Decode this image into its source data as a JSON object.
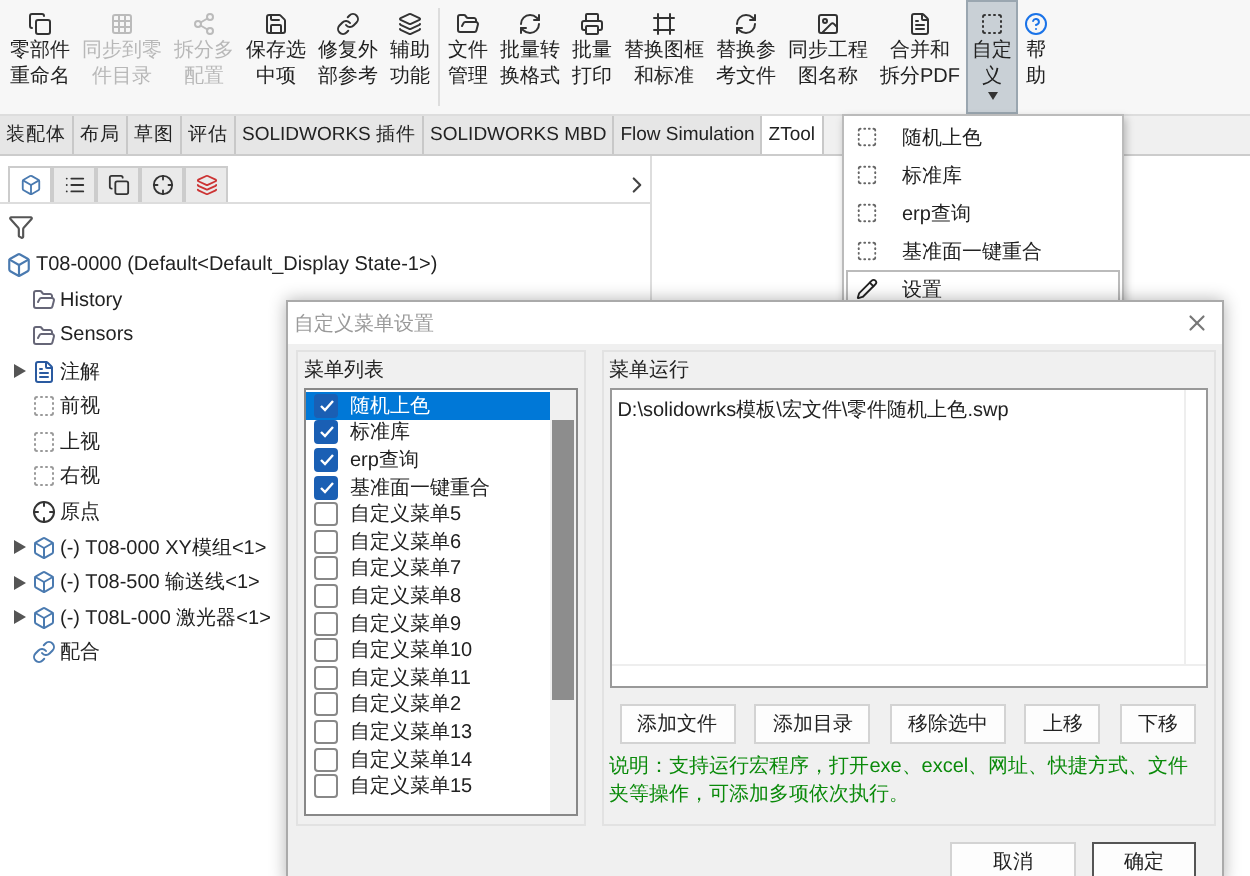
{
  "toolbar": {
    "buttons": [
      {
        "lines": [
          "零部件",
          "重命名"
        ],
        "disabled": false,
        "pressed": false
      },
      {
        "lines": [
          "同步到零",
          "件目录"
        ],
        "disabled": true,
        "pressed": false
      },
      {
        "lines": [
          "拆分多",
          "配置"
        ],
        "disabled": true,
        "pressed": false
      },
      {
        "lines": [
          "保存选",
          "中项"
        ],
        "disabled": false,
        "pressed": false
      },
      {
        "lines": [
          "修复外",
          "部参考"
        ],
        "disabled": false,
        "pressed": false
      },
      {
        "lines": [
          "辅助",
          "功能"
        ],
        "disabled": false,
        "pressed": false
      },
      {
        "lines": [
          "文件",
          "管理"
        ],
        "disabled": false,
        "pressed": false
      },
      {
        "lines": [
          "批量转",
          "换格式"
        ],
        "disabled": false,
        "pressed": false
      },
      {
        "lines": [
          "批量",
          "打印"
        ],
        "disabled": false,
        "pressed": false
      },
      {
        "lines": [
          "替换图框",
          "和标准"
        ],
        "disabled": false,
        "pressed": false
      },
      {
        "lines": [
          "替换参",
          "考文件"
        ],
        "disabled": false,
        "pressed": false
      },
      {
        "lines": [
          "同步工程",
          "图名称"
        ],
        "disabled": false,
        "pressed": false
      },
      {
        "lines": [
          "合并和",
          "拆分PDF"
        ],
        "disabled": false,
        "pressed": false
      },
      {
        "lines": [
          "自定",
          "义"
        ],
        "disabled": false,
        "pressed": true
      },
      {
        "lines": [
          "帮",
          "助"
        ],
        "disabled": false,
        "pressed": false
      }
    ]
  },
  "tabs": [
    {
      "label": "装配体",
      "selected": false
    },
    {
      "label": "布局",
      "selected": false
    },
    {
      "label": "草图",
      "selected": false
    },
    {
      "label": "评估",
      "selected": false
    },
    {
      "label": "SOLIDWORKS 插件",
      "selected": false
    },
    {
      "label": "SOLIDWORKS MBD",
      "selected": false
    },
    {
      "label": "Flow Simulation",
      "selected": false
    },
    {
      "label": "ZTool",
      "selected": true
    }
  ],
  "dropdown": {
    "items": [
      {
        "kind": "macro",
        "label": "随机上色",
        "selected": false
      },
      {
        "kind": "macro",
        "label": "标准库",
        "selected": false
      },
      {
        "kind": "macro",
        "label": "erp查询",
        "selected": false
      },
      {
        "kind": "macro",
        "label": "基准面一键重合",
        "selected": false
      },
      {
        "kind": "settings",
        "label": "设置",
        "selected": true
      }
    ]
  },
  "tree": {
    "root": {
      "label": "T08-0000  (Default<Default_Display State-1>)",
      "children": [
        {
          "kind": "history",
          "label": "History"
        },
        {
          "kind": "sensors",
          "label": "Sensors"
        },
        {
          "kind": "annotations",
          "label": "注解",
          "expanded": false
        },
        {
          "kind": "plane",
          "label": "前视"
        },
        {
          "kind": "plane",
          "label": "上视"
        },
        {
          "kind": "plane",
          "label": "右视"
        },
        {
          "kind": "origin",
          "label": "原点"
        },
        {
          "kind": "component",
          "label": "(-) T08-000 XY模组<1>",
          "expanded": false
        },
        {
          "kind": "component",
          "label": "(-) T08-500 输送线<1>",
          "expanded": false
        },
        {
          "kind": "component",
          "label": "(-) T08L-000 激光器<1>",
          "expanded": false
        },
        {
          "kind": "mates",
          "label": "配合"
        }
      ]
    }
  },
  "dialog": {
    "title": "自定义菜单设置",
    "menu_list": {
      "label": "菜单列表",
      "items": [
        {
          "label": "随机上色",
          "checked": true,
          "selected": true
        },
        {
          "label": "标准库",
          "checked": true,
          "selected": false
        },
        {
          "label": "erp查询",
          "checked": true,
          "selected": false
        },
        {
          "label": "基准面一键重合",
          "checked": true,
          "selected": false
        },
        {
          "label": "自定义菜单5",
          "checked": false,
          "selected": false
        },
        {
          "label": "自定义菜单6",
          "checked": false,
          "selected": false
        },
        {
          "label": "自定义菜单7",
          "checked": false,
          "selected": false
        },
        {
          "label": "自定义菜单8",
          "checked": false,
          "selected": false
        },
        {
          "label": "自定义菜单9",
          "checked": false,
          "selected": false
        },
        {
          "label": "自定义菜单10",
          "checked": false,
          "selected": false
        },
        {
          "label": "自定义菜单11",
          "checked": false,
          "selected": false
        },
        {
          "label": "自定义菜单2",
          "checked": false,
          "selected": false
        },
        {
          "label": "自定义菜单13",
          "checked": false,
          "selected": false
        },
        {
          "label": "自定义菜单14",
          "checked": false,
          "selected": false
        },
        {
          "label": "自定义菜单15",
          "checked": false,
          "selected": false
        }
      ]
    },
    "menu_run": {
      "label": "菜单运行",
      "value": "D:\\solidowrks模板\\宏文件\\零件随机上色.swp"
    },
    "actions": [
      "添加文件",
      "添加目录",
      "移除选中",
      "上移",
      "下移"
    ],
    "note": "说明：支持运行宏程序，打开exe、excel、网址、快捷方式、文件夹等操作，可添加多项依次执行。",
    "buttons": [
      "取消",
      "确定"
    ]
  }
}
